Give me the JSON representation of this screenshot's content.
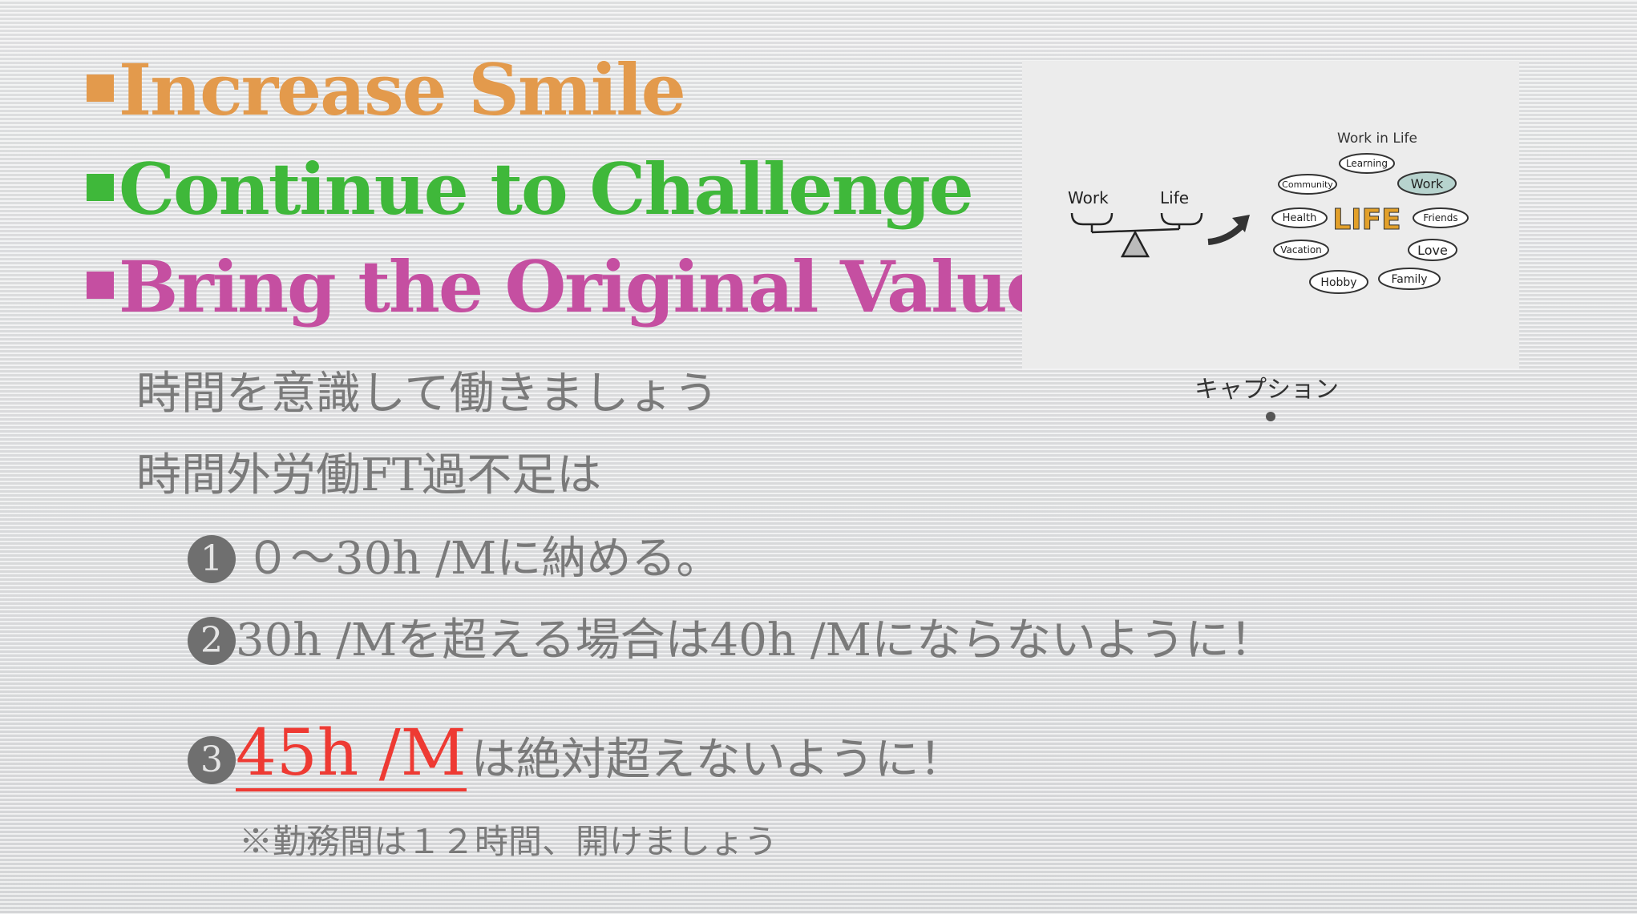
{
  "colors": {
    "orange": "#e39a4c",
    "green": "#3fb83a",
    "magenta": "#c54fa1",
    "red": "#ee3a33",
    "gray_text": "#7a7a7a"
  },
  "headings": [
    {
      "text": "Increase Smile",
      "color": "#e39a4c"
    },
    {
      "text": "Continue to Challenge",
      "color": "#3fb83a"
    },
    {
      "text": "Bring the Original Value",
      "color": "#c54fa1"
    }
  ],
  "body": {
    "line1": "時間を意識して働きましょう",
    "line2": "時間外労働FT過不足は",
    "items": [
      {
        "num": "1",
        "text": "０～30h /Mに納める。"
      },
      {
        "num": "2",
        "text": "30h /Mを超える場合は40h /Mにならないように！"
      },
      {
        "num": "3",
        "highlight": "45h /M",
        "text": "は絶対超えないように！"
      }
    ],
    "note": "※勤務間は１２時間、開けましょう"
  },
  "image": {
    "title": "Work in Life",
    "left_labels": [
      "Work",
      "Life"
    ],
    "center": "LIFE",
    "bubbles": [
      "Learning",
      "Work",
      "Community",
      "Friends",
      "Health",
      "Love",
      "Vacation",
      "Family",
      "Hobby"
    ]
  },
  "caption": "キャプション"
}
